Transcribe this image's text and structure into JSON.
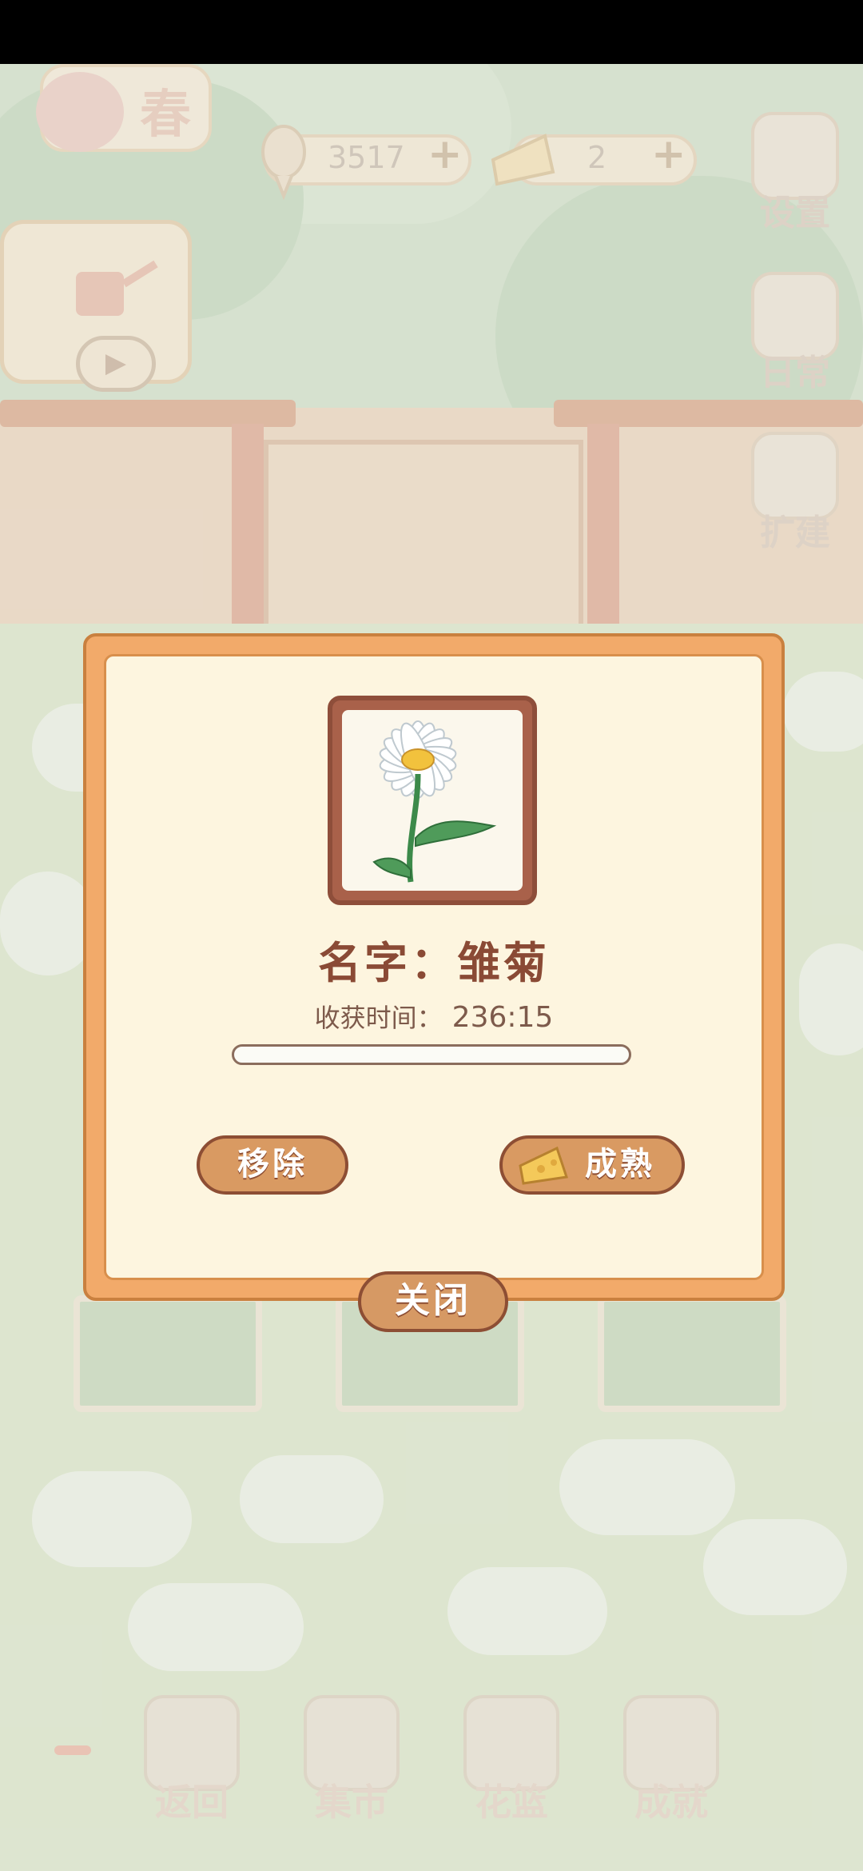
{
  "hud": {
    "season": "春",
    "fish_count": "3517",
    "cheese_count": "2",
    "plus": "+"
  },
  "side_buttons": {
    "settings": "设置",
    "daily": "日常",
    "expand": "扩建"
  },
  "dialog": {
    "name_text": "名字：雏菊",
    "harvest_label": "收获时间：",
    "harvest_time": "236:15",
    "progress": 0.0,
    "remove_label": "移除",
    "ripen_label": "成熟",
    "close_label": "关闭"
  },
  "bottom_nav": {
    "back": "返回",
    "market": "集市",
    "basket": "花篮",
    "achievements": "成就"
  },
  "icons": {
    "fish": "fish-bone-icon",
    "cheese": "cheese-icon",
    "settings": "gear-icon",
    "daily": "notebook-icon",
    "expand": "tools-icon",
    "watering": "watering-can-icon",
    "play": "play-icon"
  },
  "colors": {
    "dialog_border": "#f2aa6a",
    "dialog_bg": "#fdf5df",
    "button": "#d99a62",
    "text_brown": "#8a4a35"
  }
}
